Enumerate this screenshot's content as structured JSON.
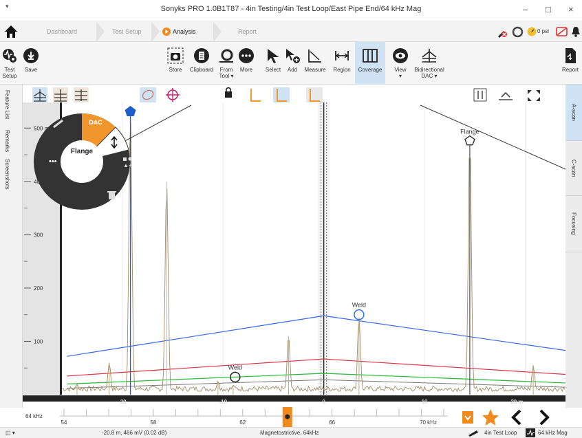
{
  "window": {
    "title": "Sonyks PRO 1.0B1T87 - 4in Testing/4in Test Loop/East Pipe End/64 kHz Mag"
  },
  "nav": {
    "items": [
      {
        "label": "Dashboard"
      },
      {
        "label": "Test Setup"
      },
      {
        "label": "Analysis"
      },
      {
        "label": "Report"
      }
    ],
    "pressure": "0 psi"
  },
  "toolbar": {
    "test_setup": "Test Setup",
    "save": "Save",
    "store": "Store",
    "clipboard": "Clipboard",
    "from_tool": "From Tool ▾",
    "more": "More",
    "select": "Select",
    "add": "Add",
    "measure": "Measure",
    "region": "Region",
    "coverage": "Coverage",
    "view": "View",
    "bidirectional": "Bidirectional DAC ▾",
    "report": "Report"
  },
  "left_tabs": [
    "Feature List",
    "Remarks",
    "Screenshots"
  ],
  "right_tabs": [
    "A-scan",
    "C-scan",
    "Focusing"
  ],
  "radial_menu": {
    "dac": "DAC",
    "feature": "Flange"
  },
  "plot": {
    "y_ticks": [
      "500 mV",
      "400",
      "300",
      "200",
      "100"
    ],
    "x_ticks": [
      "-20",
      "-10",
      "0",
      "10",
      "20 m"
    ],
    "markers": [
      {
        "label": "Flange"
      },
      {
        "label": "Weld"
      },
      {
        "label": "Weld"
      }
    ]
  },
  "chart_data": {
    "type": "line",
    "x_range": [
      -26,
      24
    ],
    "y_range": [
      0,
      530
    ],
    "xlabel": "m",
    "ylabel": "mV",
    "peaks": [
      {
        "x": -24.5,
        "y": 20
      },
      {
        "x": -21.3,
        "y": 60
      },
      {
        "x": -19.2,
        "y": 530
      },
      {
        "x": -15.6,
        "y": 400
      },
      {
        "x": -10.5,
        "y": 25
      },
      {
        "x": -9.0,
        "y": 18
      },
      {
        "x": -3.5,
        "y": 110
      },
      {
        "x": 3.5,
        "y": 145
      },
      {
        "x": 14.5,
        "y": 480
      },
      {
        "x": 20.8,
        "y": 55
      }
    ],
    "dac_curves": [
      {
        "color": "#3366ee",
        "points": [
          [
            -25.5,
            72
          ],
          [
            0,
            148
          ],
          [
            24,
            83
          ]
        ]
      },
      {
        "color": "#dd3344",
        "points": [
          [
            -25.5,
            35
          ],
          [
            0,
            67
          ],
          [
            24,
            38
          ]
        ]
      },
      {
        "color": "#22bb33",
        "points": [
          [
            -25.5,
            20
          ],
          [
            0,
            40
          ],
          [
            24,
            22
          ]
        ]
      }
    ],
    "gate": {
      "x": 0
    },
    "markers": [
      {
        "label": "Flange",
        "x": -19.2,
        "y": 530,
        "color": "#1f5ec9"
      },
      {
        "label": "Weld",
        "x": -8.8,
        "y": 33,
        "color": "#222222"
      },
      {
        "label": "Weld",
        "x": 3.5,
        "y": 150,
        "color": "#2a6fe0"
      },
      {
        "label": "Flange",
        "x": 14.5,
        "y": 475,
        "color": "#333333"
      }
    ]
  },
  "scale": {
    "freq": "64 kHz",
    "ticks": [
      "54",
      "58",
      "62",
      "66",
      "70 kHz"
    ]
  },
  "status": {
    "position": "-20.8 m, 466 mV (0.02 dB)",
    "mode": "Magnetostrictive, 64kHz",
    "loop": "4in Test Loop",
    "freq": "64 kHz Mag"
  }
}
